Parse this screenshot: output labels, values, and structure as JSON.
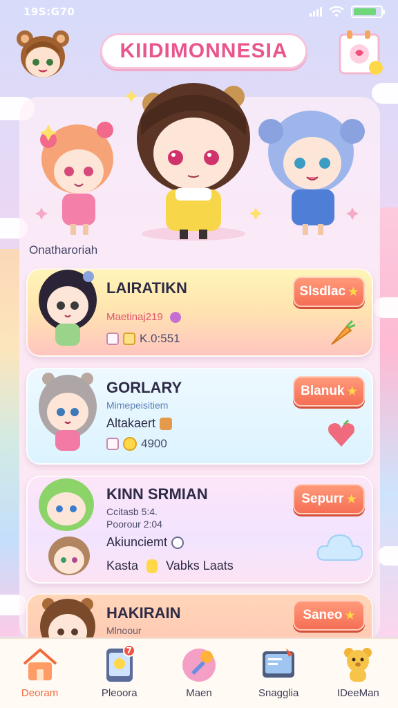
{
  "status_bar": {
    "time": "19S:G70",
    "battery_level": 0.85
  },
  "header": {
    "app_title": "KIIDIMONNESIA"
  },
  "hero": {
    "section_label": "Onatharoriah"
  },
  "cards": [
    {
      "title": "LAIRATIKN",
      "subtitle": "Maetinaj219",
      "meta": "K.0:551",
      "button": "Slsdlac",
      "deco_icon": "carrot-icon"
    },
    {
      "title": "GORLARY",
      "subtitle": "Mimepeisitiem",
      "line": "Altakaert",
      "meta": "4900",
      "button": "Blanuk",
      "deco_icon": "heart-icon"
    },
    {
      "title": "KINN SRMIAN",
      "subtitle": "Ccitasb 5:4.",
      "subtitle2": "Poorour 2:04",
      "line": "Akiunciemt",
      "meta_left": "Kasta",
      "meta_right": "Vabks Laats",
      "button": "Sepurr",
      "deco_icon": "cloud-icon"
    },
    {
      "title": "HAKIRAIN",
      "subtitle": "Mlnoour",
      "button": "Saneo",
      "deco_icon": "star-icon"
    }
  ],
  "nav": [
    {
      "label": "Deoram",
      "icon": "home-icon",
      "active": true
    },
    {
      "label": "Pleoora",
      "icon": "tablet-icon",
      "badge": "7"
    },
    {
      "label": "Maen",
      "icon": "palette-icon"
    },
    {
      "label": "Snagglia",
      "icon": "screen-icon"
    },
    {
      "label": "IDeeMan",
      "icon": "bear-icon"
    }
  ],
  "colors": {
    "accent": "#f56e55",
    "title": "#e9558d",
    "active_nav": "#f06b3e"
  }
}
